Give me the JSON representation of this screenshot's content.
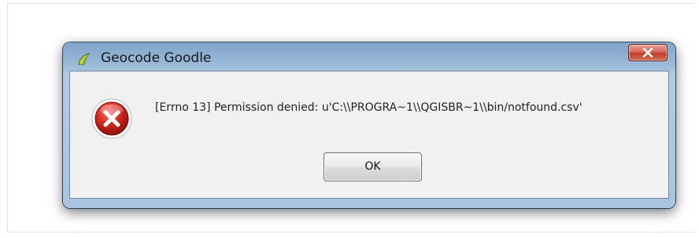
{
  "window": {
    "title": "Geocode Goodle",
    "app_icon": "qgis-logo-icon",
    "close_icon": "close-icon",
    "close_button_color": "#c8402c"
  },
  "dialog": {
    "icon": "error-icon",
    "icon_color": "#d1261d",
    "message": "[Errno 13] Permission denied: u'C:\\\\PROGRA~1\\\\QGISBR~1\\\\bin/notfound.csv'",
    "ok_label": "OK"
  }
}
